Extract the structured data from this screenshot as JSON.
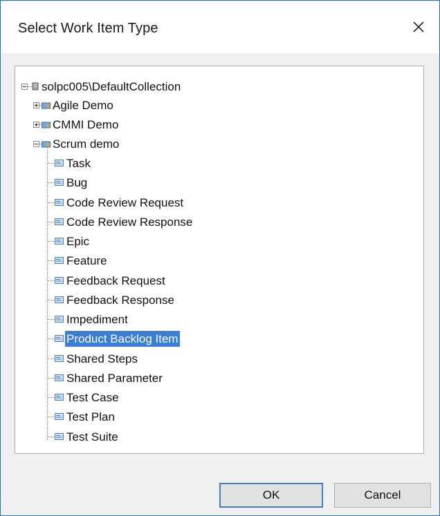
{
  "dialog": {
    "title": "Select Work Item Type",
    "close_icon": "close-icon"
  },
  "tree": {
    "root": "solpc005\\DefaultCollection",
    "projects": [
      {
        "label": "Agile Demo",
        "expanded": false
      },
      {
        "label": "CMMI Demo",
        "expanded": false
      },
      {
        "label": "Scrum demo",
        "expanded": true
      }
    ],
    "items": [
      "Task",
      "Bug",
      "Code Review Request",
      "Code Review Response",
      "Epic",
      "Feature",
      "Feedback Request",
      "Feedback Response",
      "Impediment",
      "Product Backlog Item",
      "Shared Steps",
      "Shared Parameter",
      "Test Case",
      "Test Plan",
      "Test Suite"
    ],
    "selected_item": "Product Backlog Item"
  },
  "buttons": {
    "ok": "OK",
    "cancel": "Cancel"
  },
  "colors": {
    "selection": "#3b7fd4",
    "dialog_border": "#2a6fb8",
    "footer": "#f0f0f0"
  }
}
